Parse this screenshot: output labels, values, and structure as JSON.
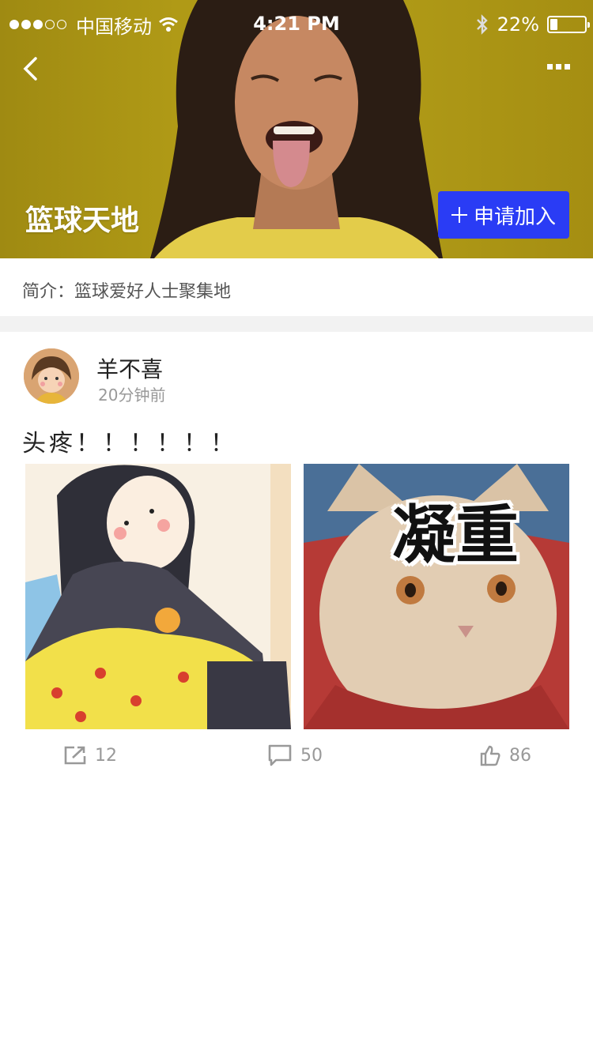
{
  "status_bar": {
    "carrier": "中国移动",
    "time": "4:21 PM",
    "battery_percent": "22%",
    "battery_level": 0.22
  },
  "group": {
    "title": "篮球天地",
    "join_label": "申请加入",
    "intro": "简介：篮球爱好人士聚集地"
  },
  "post": {
    "author": "羊不喜",
    "time_ago": "20分钟前",
    "text": "头疼！！！！！！",
    "meme_caption": "凝重",
    "share_count": "12",
    "comment_count": "50",
    "like_count": "86"
  },
  "colors": {
    "header_bg": "#b09a16",
    "join_button": "#2a3cf5",
    "divider": "#f2f2f2"
  },
  "icons": [
    "back-icon",
    "more-icon",
    "plus-icon",
    "share-icon",
    "comment-icon",
    "like-icon",
    "wifi-icon",
    "bluetooth-icon",
    "battery-icon"
  ]
}
